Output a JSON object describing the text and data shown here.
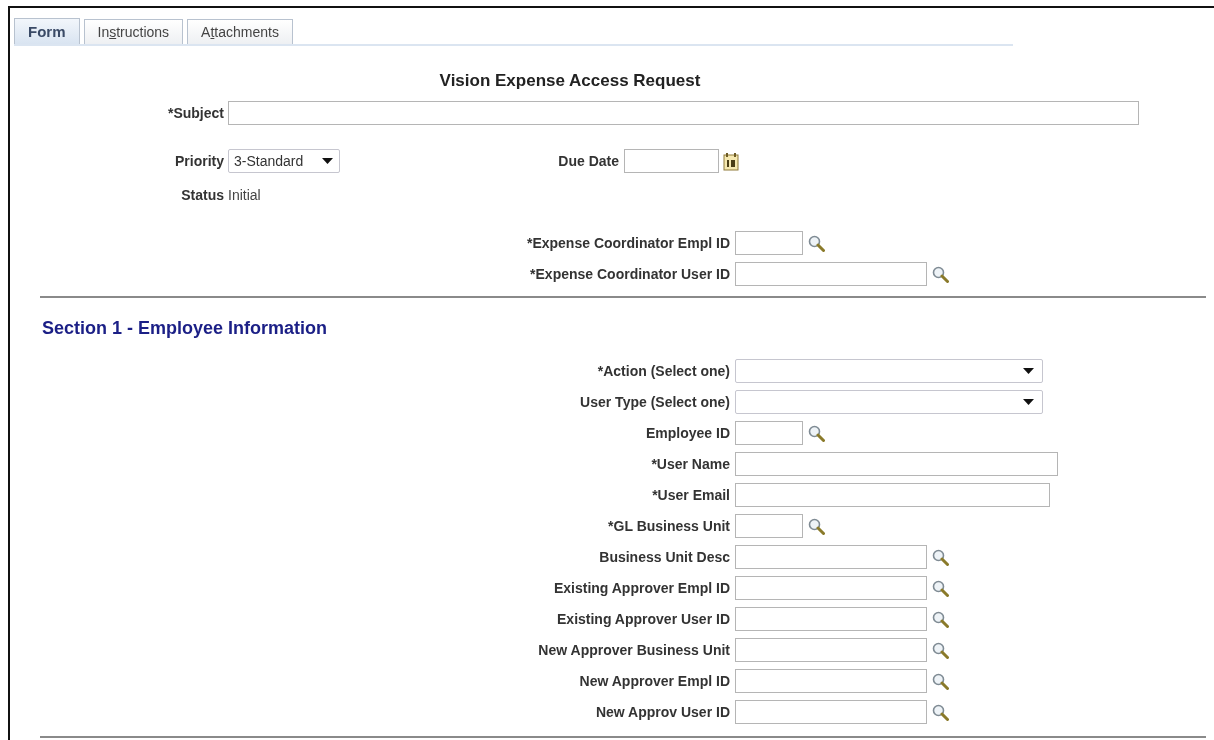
{
  "tabs": [
    {
      "label": "Form",
      "selected": true
    },
    {
      "label": "Instructions",
      "selected": false
    },
    {
      "label": "Attachments",
      "selected": false
    }
  ],
  "title": "Vision Expense Access Request",
  "header": {
    "subject": {
      "label": "*Subject"
    },
    "priority": {
      "label": "Priority",
      "value": "3-Standard"
    },
    "due_date": {
      "label": "Due Date"
    },
    "status": {
      "label": "Status",
      "value": "Initial"
    }
  },
  "coordinator_fields": [
    {
      "label": "*Expense Coordinator Empl ID",
      "kind": "lookup"
    },
    {
      "label": "*Expense Coordinator User ID",
      "kind": "lookup"
    }
  ],
  "section": {
    "title": "Section 1 - Employee Information",
    "fields": [
      {
        "label": "*Action (Select one)",
        "kind": "select"
      },
      {
        "label": "User Type (Select one)",
        "kind": "select"
      },
      {
        "label": "Employee ID",
        "kind": "lookup"
      },
      {
        "label": "*User Name",
        "kind": "text"
      },
      {
        "label": "*User Email",
        "kind": "text"
      },
      {
        "label": "*GL Business Unit",
        "kind": "lookup"
      },
      {
        "label": "Business Unit Desc",
        "kind": "lookup"
      },
      {
        "label": "Existing Approver Empl ID",
        "kind": "lookup"
      },
      {
        "label": "Existing Approver User ID",
        "kind": "lookup"
      },
      {
        "label": "New Approver Business Unit",
        "kind": "lookup"
      },
      {
        "label": "New Approver Empl ID",
        "kind": "lookup"
      },
      {
        "label": "New Approv User ID",
        "kind": "lookup"
      }
    ]
  }
}
